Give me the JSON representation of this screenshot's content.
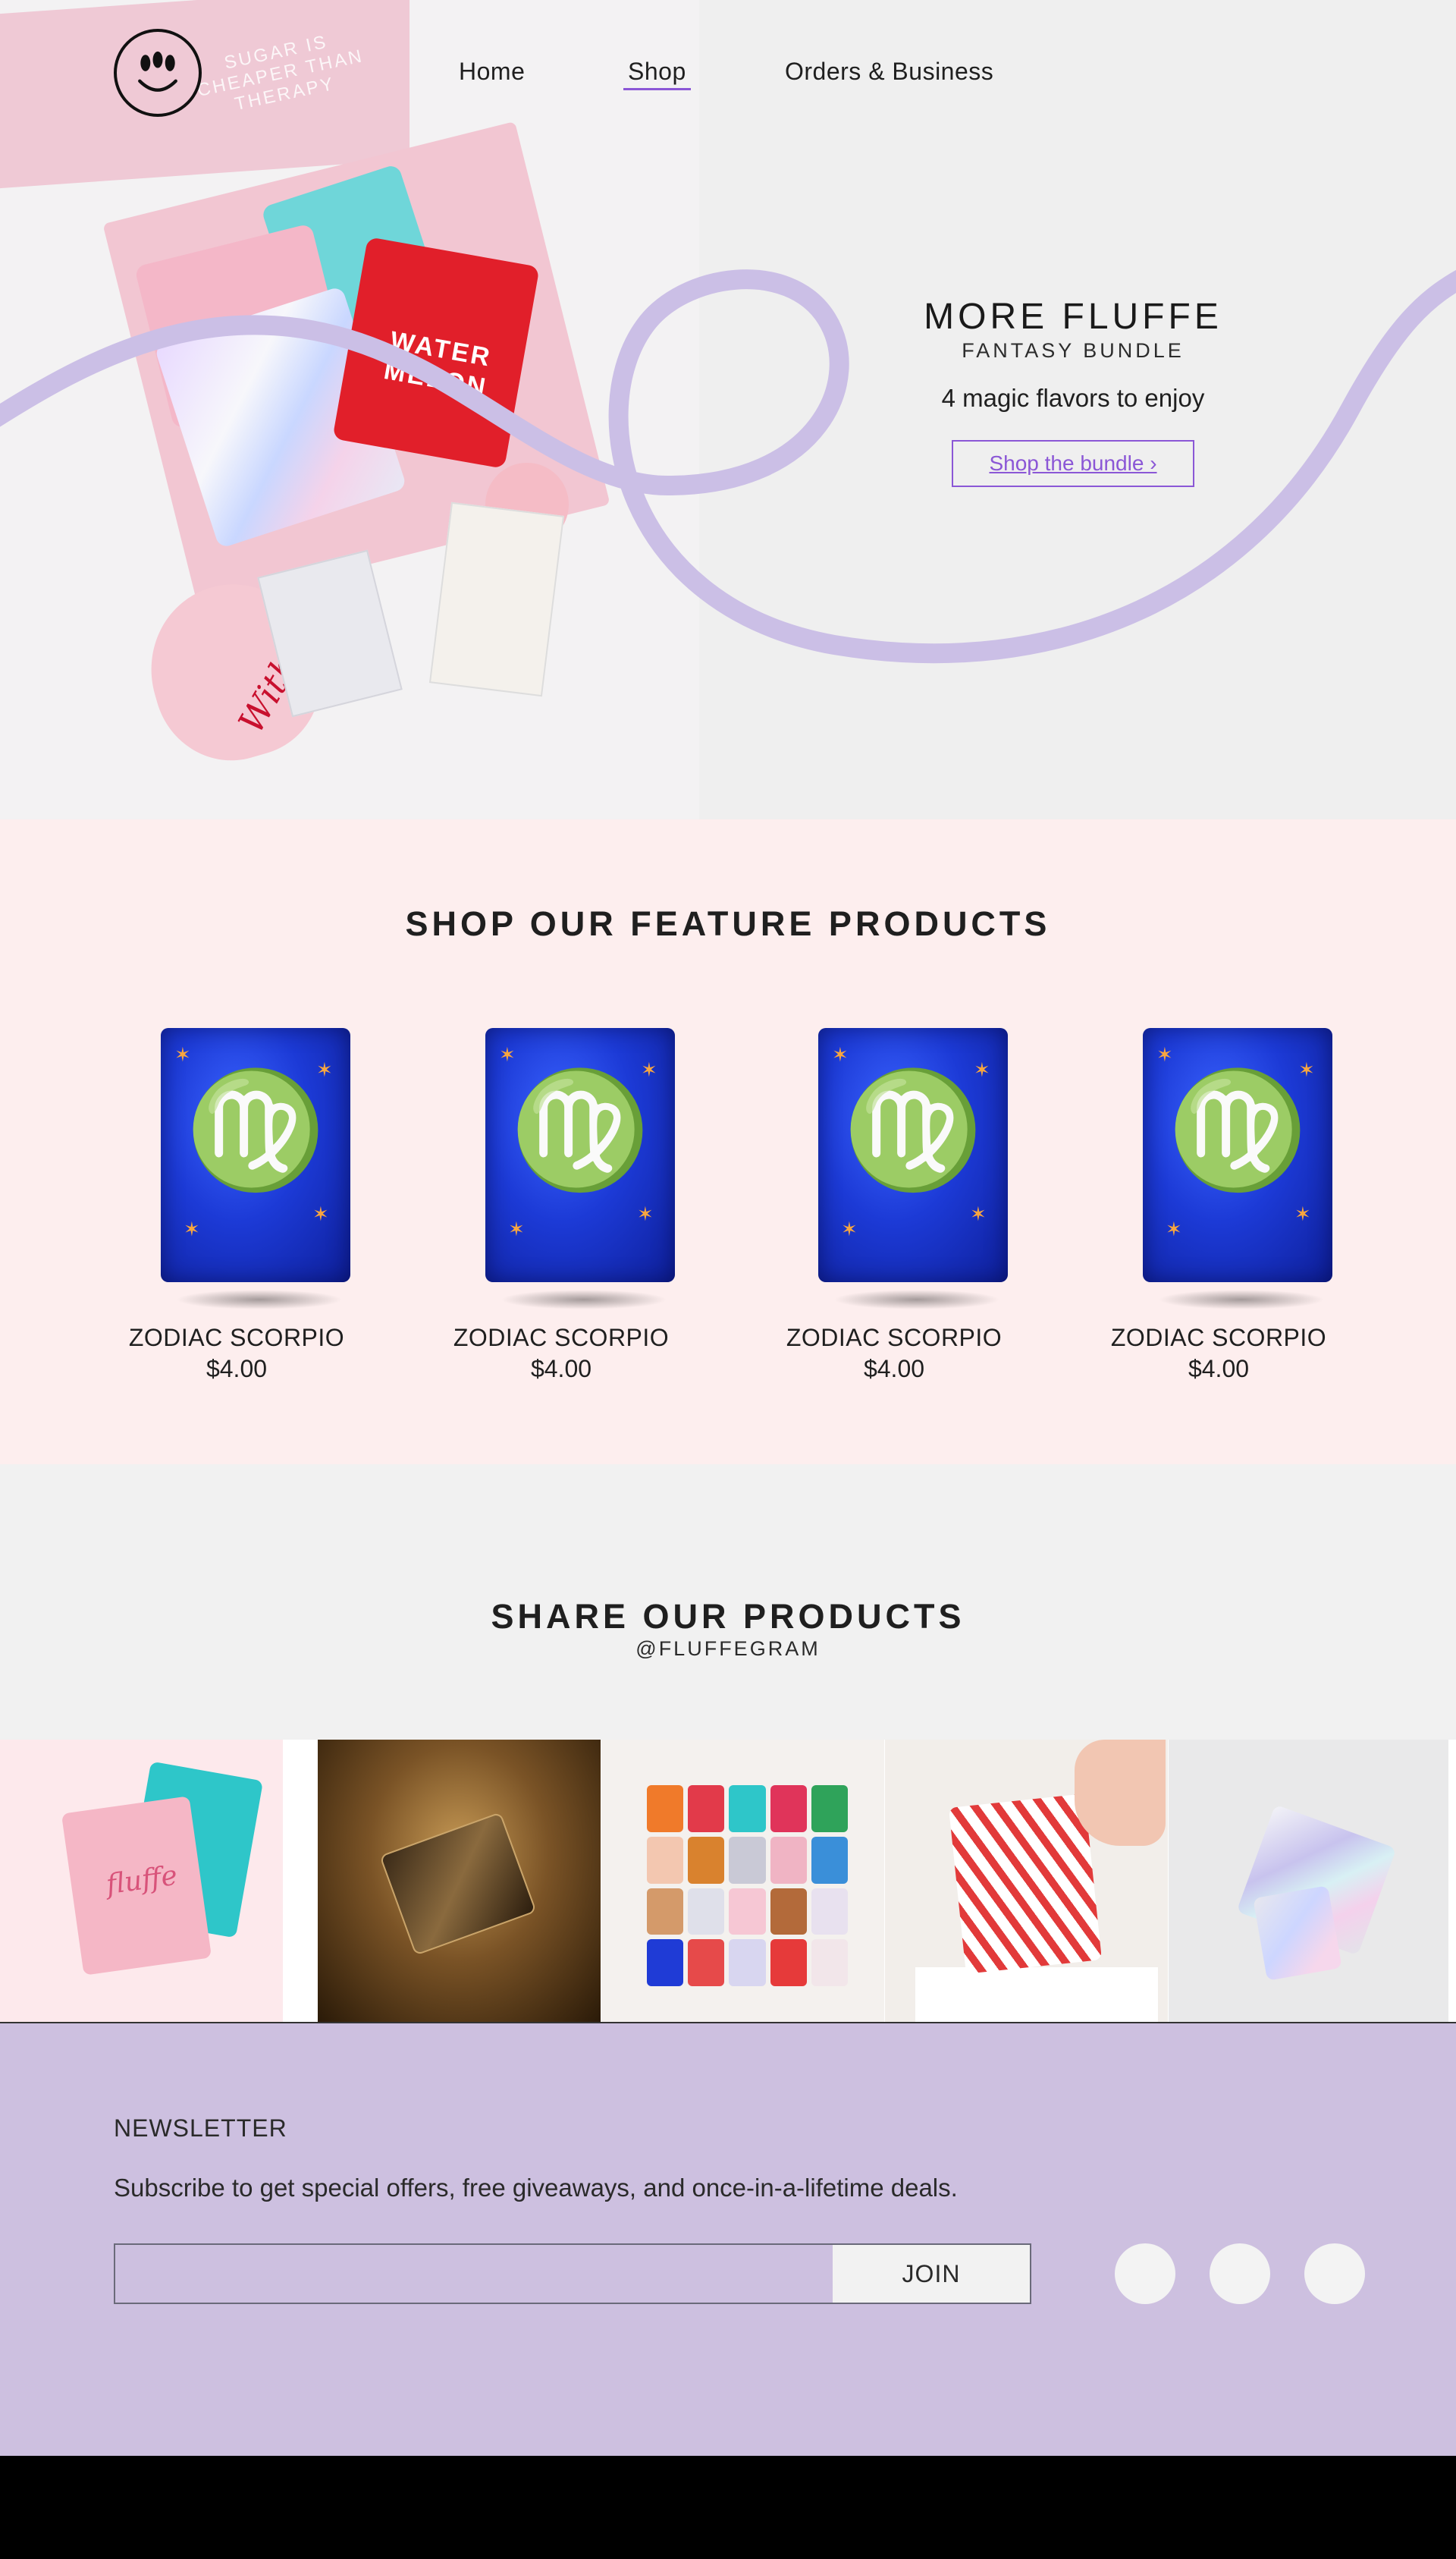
{
  "nav": {
    "items": [
      {
        "label": "Home"
      },
      {
        "label": "Shop",
        "active": true
      },
      {
        "label": "Orders & Business"
      }
    ]
  },
  "hero": {
    "title": "MORE FLUFFE",
    "subtitle": "FANTASY BUNDLE",
    "description": "4 magic flavors to enjoy",
    "button_label": "Shop the bundle ›",
    "box_text": "SUGAR IS CHEAPER THAN THERAPY",
    "bag_text": "WATER MELON",
    "card_text": "With Love"
  },
  "features": {
    "title": "SHOP OUR FEATURE PRODUCTS",
    "products": [
      {
        "name": "ZODIAC SCORPIO",
        "price": "$4.00"
      },
      {
        "name": "ZODIAC SCORPIO",
        "price": "$4.00"
      },
      {
        "name": "ZODIAC SCORPIO",
        "price": "$4.00"
      },
      {
        "name": "ZODIAC SCORPIO",
        "price": "$4.00"
      }
    ]
  },
  "share": {
    "title": "SHARE OUR PRODUCTS",
    "handle": "@FLUFFEGRAM"
  },
  "newsletter": {
    "title": "NEWSLETTER",
    "text": "Subscribe to get special offers, free giveaways, and once-in-a-lifetime deals.",
    "email_placeholder": "",
    "join_label": "JOIN"
  },
  "social": {
    "icons": [
      "social-icon-1",
      "social-icon-2",
      "social-icon-3"
    ]
  },
  "colors": {
    "accent": "#8b57d6",
    "ribbon": "#cbbfe6",
    "feature_bg": "#fdeeee",
    "newsletter_bg": "#cdc0e0"
  }
}
